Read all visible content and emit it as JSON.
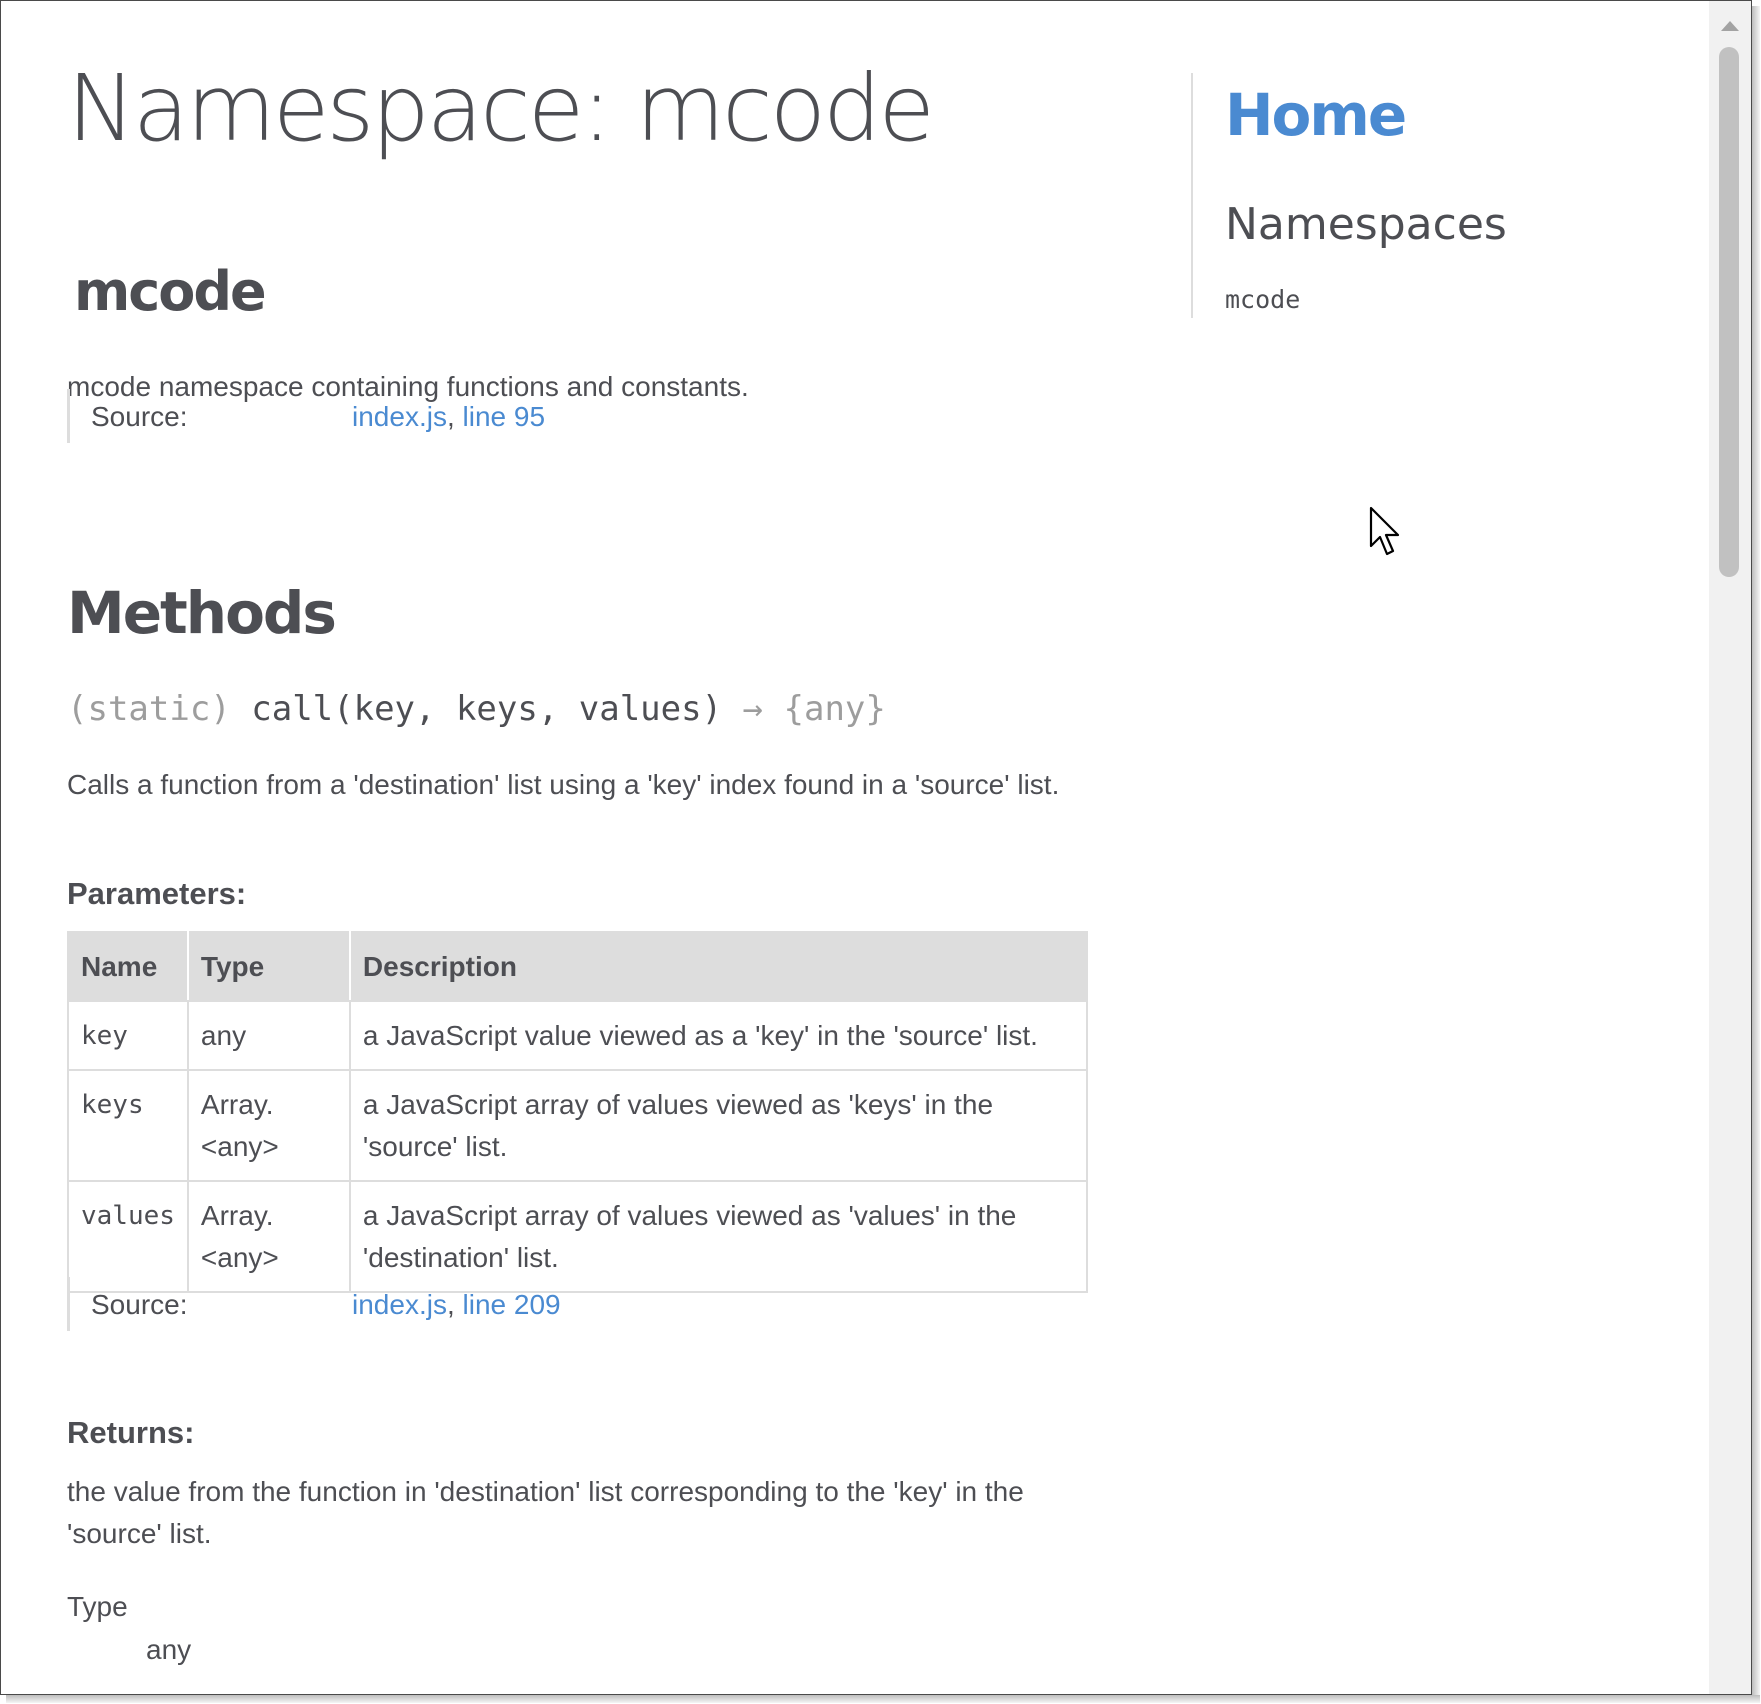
{
  "page": {
    "title": "Namespace: mcode",
    "namespace_name": "mcode",
    "namespace_description": "mcode namespace containing functions and constants."
  },
  "namespace_source": {
    "label": "Source:",
    "file": "index.js",
    "separator": ",",
    "line": "line 95"
  },
  "methods": {
    "heading": "Methods",
    "signature": {
      "modifier": "(static)",
      "name": "call(key, keys, values)",
      "arrow": "→",
      "return_type": "{any}"
    },
    "description": "Calls a function from a 'destination' list using a 'key' index found in a 'source' list.",
    "parameters_heading": "Parameters:",
    "table": {
      "headers": [
        "Name",
        "Type",
        "Description"
      ],
      "rows": [
        {
          "name": "key",
          "type": "any",
          "description": "a JavaScript value viewed as a 'key' in the 'source' list."
        },
        {
          "name": "keys",
          "type": "Array.<any>",
          "description": "a JavaScript array of values viewed as 'keys' in the 'source' list."
        },
        {
          "name": "values",
          "type": "Array.<any>",
          "description": "a JavaScript array of values viewed as 'values' in the 'destination' list."
        }
      ]
    },
    "source": {
      "label": "Source:",
      "file": "index.js",
      "separator": ",",
      "line": "line 209"
    },
    "returns_heading": "Returns:",
    "returns_description": "the value from the function in 'destination' list corresponding to the 'key' in the 'source' list.",
    "type_label": "Type",
    "type_value": "any"
  },
  "nav": {
    "home": "Home",
    "section_title": "Namespaces",
    "items": [
      "mcode"
    ]
  },
  "icons": {
    "scroll_up": "triangle-up-icon",
    "cursor": "mouse-pointer-icon"
  },
  "colors": {
    "link": "#4a8ad1",
    "text": "#4d4e53",
    "muted": "#9d9d9d",
    "table_header_bg": "#dddddd"
  }
}
